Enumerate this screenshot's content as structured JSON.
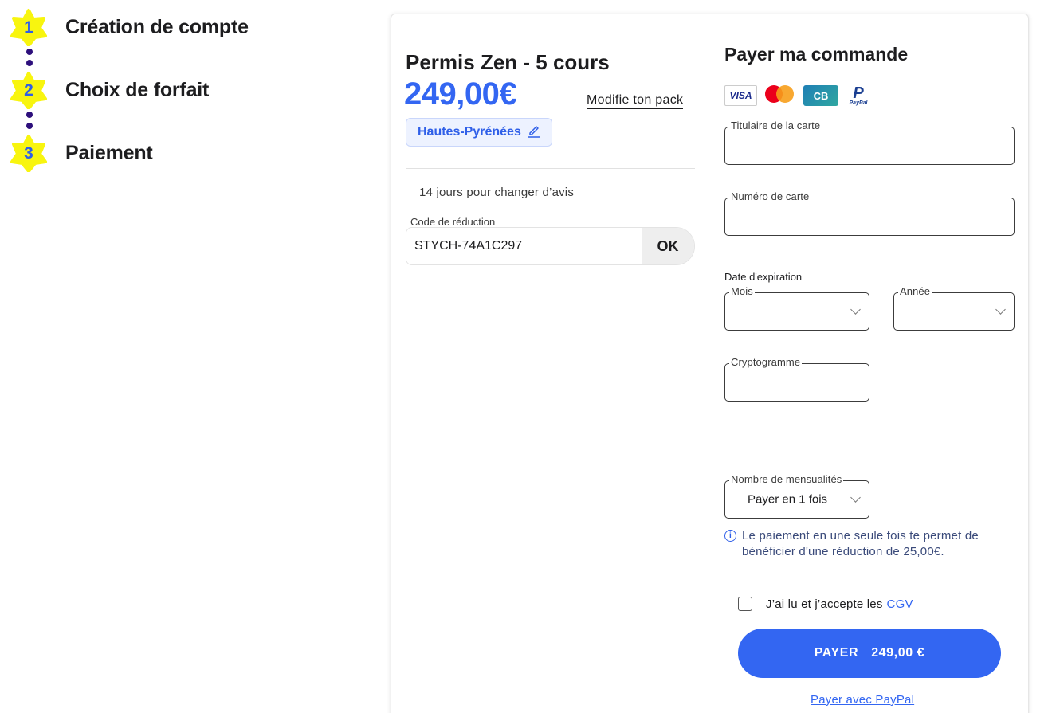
{
  "stepper": {
    "steps": [
      {
        "number": "1",
        "label": "Création de compte"
      },
      {
        "number": "2",
        "label": "Choix de forfait"
      },
      {
        "number": "3",
        "label": "Paiement"
      }
    ]
  },
  "pack": {
    "title": "Permis Zen - 5 cours",
    "price": "249,00€",
    "modify_label": "Modifie ton pack",
    "region": "Hautes-Pyrénées",
    "retract_note": "14 jours pour changer d’avis",
    "promo_label": "Code de réduction",
    "promo_value": "STYCH-74A1C297",
    "promo_button": "OK"
  },
  "payment": {
    "title": "Payer ma commande",
    "logos": {
      "visa": "VISA",
      "cb": "CB",
      "paypal": "P",
      "paypal_text": "PayPal"
    },
    "card_holder_label": "Titulaire de la carte",
    "card_number_label": "Numéro de carte",
    "expiry_label": "Date d'expiration",
    "month_label": "Mois",
    "year_label": "Année",
    "cvv_label": "Cryptogramme",
    "installments_label": "Nombre de mensualités",
    "installments_value": "Payer en 1 fois",
    "info_icon": "i",
    "info_text": "Le paiement en une seule fois te permet de bénéficier d'une réduction de 25,00€.",
    "cgv_text": "J’ai lu et j’accepte les",
    "cgv_link": "CGV",
    "pay_button_label": "PAYER",
    "pay_button_amount": "249,00 €",
    "paypal_link": "Payer avec PayPal"
  },
  "colors": {
    "accent": "#3366f2",
    "star": "#f8f50f",
    "step_dots": "#2d0f7c"
  }
}
